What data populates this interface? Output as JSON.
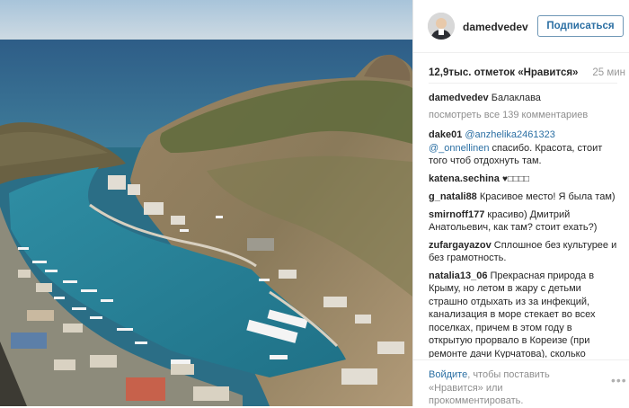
{
  "post": {
    "username": "damedvedev",
    "follow_label": "Подписаться",
    "likes": "12,9тыс. отметок «Нравится»",
    "time": "25 мин",
    "caption_author": "damedvedev",
    "caption_text": "Балаклава",
    "view_all": "посмотреть все 139 комментариев"
  },
  "comments": [
    {
      "author": "dake01",
      "mention": "@anzhelika2461323 @_onnellinen",
      "text": " спасибо. Красота, стоит того чтоб отдохнуть там."
    },
    {
      "author": "katena.sechina",
      "text": "♥□□□□"
    },
    {
      "author": "g_natali88",
      "text": "Красивое место! Я была там)"
    },
    {
      "author": "smirnoff177",
      "text": "красиво) Дмитрий Анатольевич, как там? стоит ехать?)"
    },
    {
      "author": "zufargayazov",
      "text": "Сплошное без культурее и без грамотность."
    },
    {
      "author": "natalia13_06",
      "text": "Прекрасная природа в Крыму, но летом в жару с детьми страшно отдыхать из за инфекций, канализация в море стекает во всех поселках, причем в этом году в открытую прорвало в Кореизе (при ремонте дачи Курчатова), сколько"
    }
  ],
  "footer": {
    "login_link": "Войдите",
    "text": ", чтобы поставить «Нравится» или прокомментировать."
  },
  "icons": {
    "more": "more-options-icon"
  }
}
